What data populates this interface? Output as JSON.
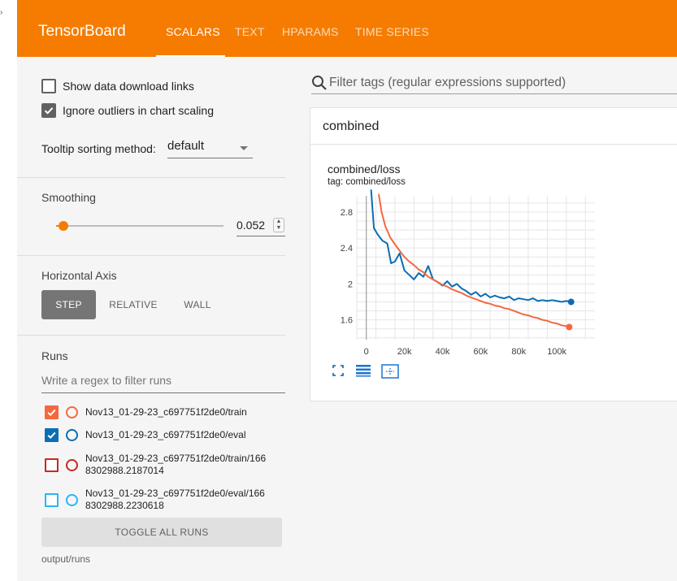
{
  "corner_glyph": "›",
  "header": {
    "brand": "TensorBoard",
    "tabs": [
      {
        "label": "SCALARS",
        "active": true
      },
      {
        "label": "TEXT",
        "active": false
      },
      {
        "label": "HPARAMS",
        "active": false
      },
      {
        "label": "TIME SERIES",
        "active": false
      }
    ],
    "accent_color": "#f57c00"
  },
  "sidebar": {
    "show_download_links": {
      "label": "Show data download links",
      "checked": false
    },
    "ignore_outliers": {
      "label": "Ignore outliers in chart scaling",
      "checked": true
    },
    "tooltip_sorting": {
      "label": "Tooltip sorting method:",
      "value": "default"
    },
    "smoothing": {
      "title": "Smoothing",
      "value": "0.052",
      "fraction": 0.052
    },
    "horizontal_axis": {
      "title": "Horizontal Axis",
      "options": [
        {
          "label": "STEP",
          "active": true
        },
        {
          "label": "RELATIVE",
          "active": false
        },
        {
          "label": "WALL",
          "active": false
        }
      ]
    },
    "runs": {
      "title": "Runs",
      "filter_placeholder": "Write a regex to filter runs",
      "items": [
        {
          "line1": "Nov13_01-29-23_c697751f2de0/train",
          "line2": "",
          "checked": true,
          "color": "#f4683f"
        },
        {
          "line1": "Nov13_01-29-23_c697751f2de0/eval",
          "line2": "",
          "checked": true,
          "color": "#0a6eb5"
        },
        {
          "line1": "Nov13_01-29-23_c697751f2de0/train/166",
          "line2": "8302988.2187014",
          "checked": false,
          "color": "#c62828"
        },
        {
          "line1": "Nov13_01-29-23_c697751f2de0/eval/166",
          "line2": "8302988.2230618",
          "checked": false,
          "color": "#29b6f6"
        }
      ],
      "toggle_all_label": "TOGGLE ALL RUNS",
      "log_dir": "output/runs"
    }
  },
  "main": {
    "tag_filter_placeholder": "Filter tags (regular expressions supported)",
    "group_name": "combined",
    "card": {
      "title": "combined/loss",
      "tag_label": "tag: combined/loss"
    }
  },
  "chart_data": {
    "type": "line",
    "title": "combined/loss",
    "xlabel": "",
    "ylabel": "",
    "xlim": [
      -5000,
      120000
    ],
    "ylim": [
      1.38,
      2.98
    ],
    "x_ticks": [
      {
        "label": "0",
        "value": 0
      },
      {
        "label": "20k",
        "value": 20000
      },
      {
        "label": "40k",
        "value": 40000
      },
      {
        "label": "60k",
        "value": 60000
      },
      {
        "label": "80k",
        "value": 80000
      },
      {
        "label": "100k",
        "value": 100000
      }
    ],
    "y_ticks": [
      {
        "label": "1.6",
        "value": 1.6
      },
      {
        "label": "2",
        "value": 2.0
      },
      {
        "label": "2.4",
        "value": 2.4
      },
      {
        "label": "2.8",
        "value": 2.8
      }
    ],
    "grid": true,
    "series": [
      {
        "run": "Nov13_01-29-23_c697751f2de0/eval",
        "color": "#0a6eb5",
        "x": [
          2500,
          4000,
          6000,
          8500,
          11000,
          13000,
          15000,
          17500,
          20000,
          22500,
          25000,
          27500,
          30000,
          32500,
          35000,
          37500,
          40000,
          42500,
          45000,
          47500,
          50000,
          52500,
          55000,
          57500,
          60000,
          62500,
          65000,
          67500,
          70000,
          72500,
          75000,
          77500,
          80000,
          82500,
          85000,
          87500,
          90000,
          92500,
          95000,
          97500,
          100000,
          102500,
          105000,
          107500
        ],
        "values": [
          3.05,
          2.62,
          2.55,
          2.48,
          2.45,
          2.23,
          2.25,
          2.34,
          2.15,
          2.1,
          2.05,
          2.12,
          2.08,
          2.2,
          2.05,
          2.02,
          1.98,
          2.03,
          1.97,
          2.0,
          1.95,
          1.92,
          1.88,
          1.91,
          1.86,
          1.89,
          1.85,
          1.87,
          1.85,
          1.84,
          1.86,
          1.82,
          1.84,
          1.83,
          1.82,
          1.84,
          1.81,
          1.82,
          1.81,
          1.82,
          1.81,
          1.8,
          1.81,
          1.8
        ]
      },
      {
        "run": "Nov13_01-29-23_c697751f2de0/train",
        "color": "#f4683f",
        "x": [
          6500,
          8000,
          10000,
          12500,
          15000,
          17500,
          20000,
          22500,
          25000,
          27500,
          30000,
          32500,
          35000,
          37500,
          40000,
          42500,
          45000,
          47500,
          50000,
          52500,
          55000,
          57500,
          60000,
          62500,
          65000,
          67500,
          70000,
          72500,
          75000,
          77500,
          80000,
          82500,
          85000,
          87500,
          90000,
          92500,
          95000,
          97500,
          100000,
          102500,
          105000,
          106500
        ],
        "values": [
          3.0,
          2.8,
          2.64,
          2.52,
          2.44,
          2.37,
          2.3,
          2.25,
          2.21,
          2.16,
          2.13,
          2.08,
          2.05,
          2.02,
          1.99,
          1.97,
          1.94,
          1.92,
          1.9,
          1.87,
          1.85,
          1.83,
          1.81,
          1.79,
          1.78,
          1.76,
          1.75,
          1.73,
          1.72,
          1.7,
          1.68,
          1.66,
          1.65,
          1.63,
          1.62,
          1.6,
          1.59,
          1.57,
          1.56,
          1.54,
          1.53,
          1.52
        ]
      }
    ]
  }
}
